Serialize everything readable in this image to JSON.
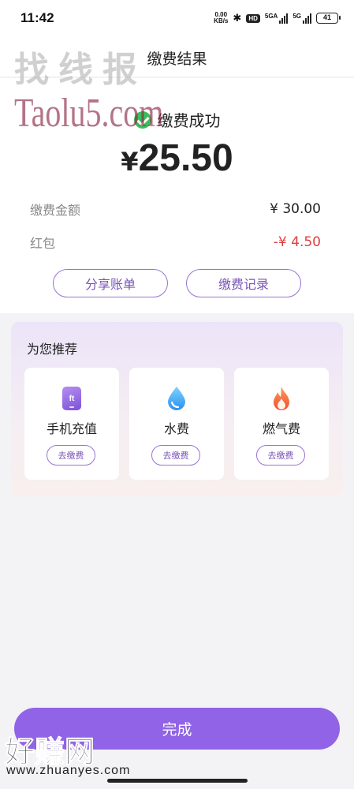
{
  "status_bar": {
    "time": "11:42",
    "speed_value": "0.00",
    "speed_unit": "KB/s",
    "hd_badge": "HD",
    "network_1": "5GA",
    "network_2": "5G",
    "battery": "41"
  },
  "header": {
    "title": "缴费结果"
  },
  "result": {
    "status_text": "缴费成功",
    "currency_symbol": "¥",
    "amount": "25.50",
    "rows": [
      {
        "label": "缴费金额",
        "value": "¥ 30.00"
      },
      {
        "label": "红包",
        "value": "-¥ 4.50",
        "color": "#e03c3c"
      }
    ],
    "share_button": "分享账单",
    "records_button": "缴费记录"
  },
  "recommend": {
    "title": "为您推荐",
    "items": [
      {
        "label": "手机充值",
        "button": "去缴费",
        "icon": "phone-recharge-icon",
        "icon_text": "ft"
      },
      {
        "label": "水费",
        "button": "去缴费",
        "icon": "water-drop-icon"
      },
      {
        "label": "燃气费",
        "button": "去缴费",
        "icon": "flame-icon"
      }
    ]
  },
  "done_button": "完成",
  "watermarks": {
    "top_text": "找线报",
    "top_url": "Taolu5.com",
    "bottom_text": "好赚网",
    "bottom_url": "www.zhuanyes.com"
  },
  "colors": {
    "accent": "#9163e6",
    "success": "#3bbf5a",
    "negative": "#e03c3c"
  }
}
